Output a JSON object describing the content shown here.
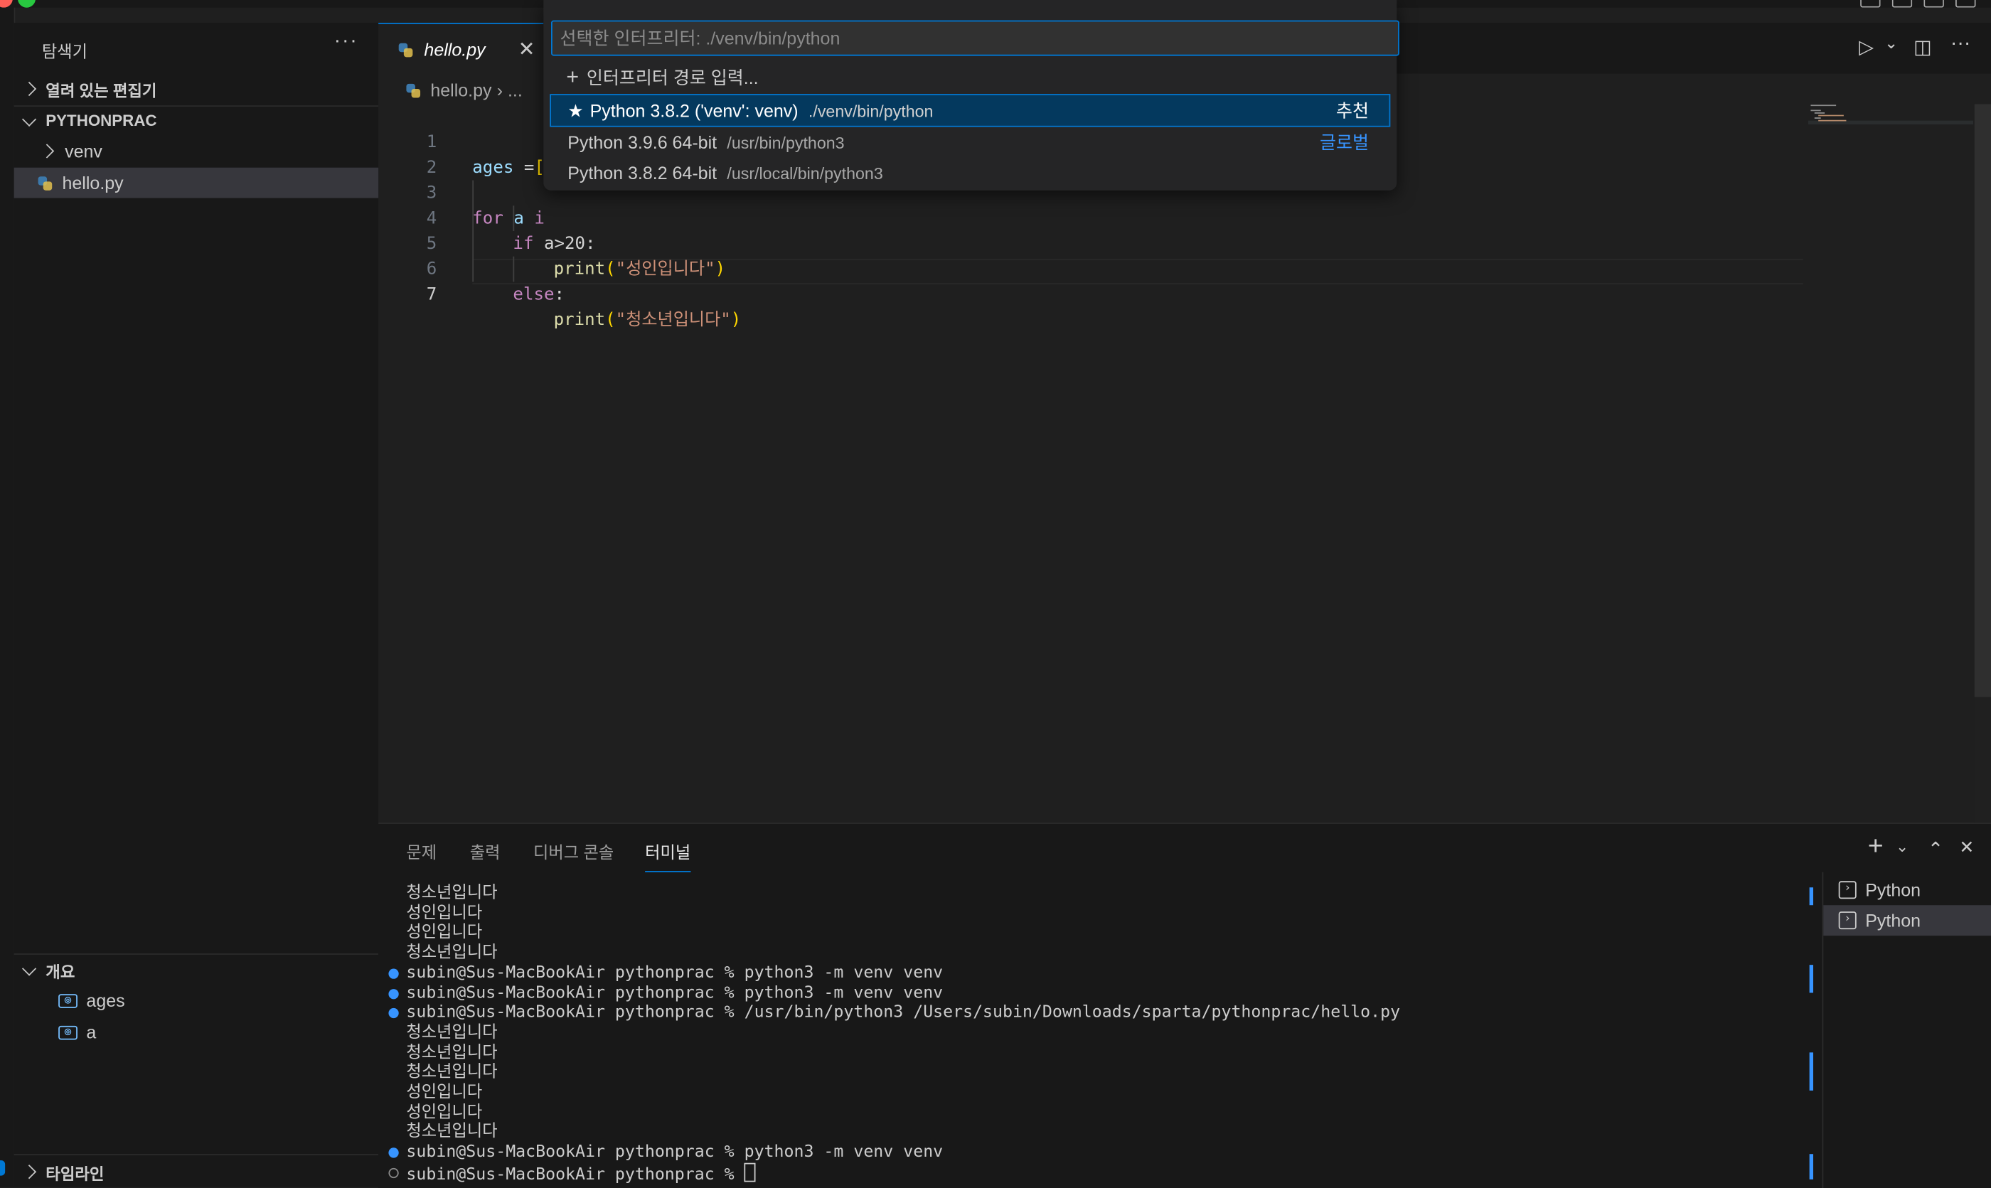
{
  "explorer": {
    "title": "탐색기",
    "more": "···",
    "open_editors": "열려 있는 편집기",
    "folder": "PYTHONPRAC",
    "items": [
      {
        "label": "venv",
        "type": "folder"
      },
      {
        "label": "hello.py",
        "type": "file"
      }
    ],
    "outline": {
      "title": "개요",
      "items": [
        {
          "icon": "[⊚]",
          "label": "ages"
        },
        {
          "icon": "[⊚]",
          "label": "a"
        }
      ]
    },
    "timeline": "타임라인"
  },
  "editor": {
    "tab_label": "hello.py",
    "tab_close": "✕",
    "breadcrumb_file": "hello.py",
    "breadcrumb_rest": "› ...",
    "actions": {
      "run": "▷",
      "run_menu": "⌄",
      "split": "◫",
      "more": "···"
    },
    "line_numbers": [
      "1",
      "2",
      "3",
      "4",
      "5",
      "6",
      "7"
    ],
    "code": {
      "l1_ages": "ages",
      "l1_rest": " =",
      "l1_bracket": "[",
      "l3_for": "for",
      "l3_a": " a",
      "l3_in": " i",
      "l4_if": "if",
      "l4_cond": " a>20:",
      "l5_print": "print",
      "l5_open": "(",
      "l5_str": "\"성인입니다\"",
      "l5_close": ")",
      "l6_else": "else",
      "l6_colon": ":",
      "l7_print": "print",
      "l7_open": "(",
      "l7_str": "\"청소년입니다\"",
      "l7_close": ")"
    }
  },
  "quick_pick": {
    "placeholder": "선택한 인터프리터: ./venv/bin/python",
    "enter_path": "인터프리터 경로 입력...",
    "options": [
      {
        "label": "Python 3.8.2 ('venv': venv)",
        "detail": "./venv/bin/python",
        "tag": "추천",
        "starred": true
      },
      {
        "label": "Python 3.9.6 64-bit",
        "detail": "/usr/bin/python3",
        "tag": "글로벌"
      },
      {
        "label": "Python 3.8.2 64-bit",
        "detail": "/usr/local/bin/python3",
        "tag": ""
      }
    ]
  },
  "panel": {
    "tabs": [
      "문제",
      "출력",
      "디버그 콘솔",
      "터미널"
    ],
    "active_tab": "터미널",
    "actions": {
      "add": "+",
      "add_menu": "⌄",
      "maximize": "⌃",
      "close": "✕"
    },
    "terminal_lines": [
      {
        "text": "청소년입니다",
        "deco": "none"
      },
      {
        "text": "성인입니다",
        "deco": "none"
      },
      {
        "text": "성인입니다",
        "deco": "none"
      },
      {
        "text": "청소년입니다",
        "deco": "none"
      },
      {
        "text": "subin@Sus-MacBookAir pythonprac % python3 -m venv venv",
        "deco": "blue"
      },
      {
        "text": "subin@Sus-MacBookAir pythonprac % python3 -m venv venv",
        "deco": "blue"
      },
      {
        "text": "subin@Sus-MacBookAir pythonprac % /usr/bin/python3 /Users/subin/Downloads/sparta/pythonprac/hello.py",
        "deco": "blue"
      },
      {
        "text": "청소년입니다",
        "deco": "none"
      },
      {
        "text": "청소년입니다",
        "deco": "none"
      },
      {
        "text": "청소년입니다",
        "deco": "none"
      },
      {
        "text": "성인입니다",
        "deco": "none"
      },
      {
        "text": "성인입니다",
        "deco": "none"
      },
      {
        "text": "청소년입니다",
        "deco": "none"
      },
      {
        "text": "subin@Sus-MacBookAir pythonprac % python3 -m venv venv",
        "deco": "blue"
      },
      {
        "text": "subin@Sus-MacBookAir pythonprac % ",
        "deco": "hollow"
      }
    ],
    "terminal_list": [
      "Python",
      "Python"
    ]
  },
  "colors": {
    "accent": "#0078d4",
    "tag_global": "#3794ff",
    "string": "#ce9178",
    "keyword": "#c586c0"
  }
}
